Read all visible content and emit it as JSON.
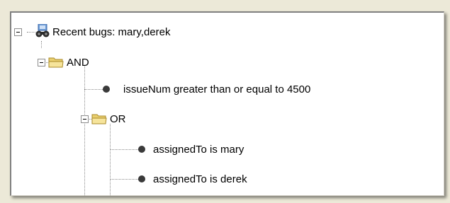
{
  "tree": {
    "root": {
      "label": "Recent bugs: mary,derek",
      "icon": "query-binoculars-icon",
      "expanded": true
    },
    "and_node": {
      "label": "AND",
      "icon": "folder-open-icon",
      "expanded": true
    },
    "cond_issue": {
      "label": "issueNum greater than or equal to 4500",
      "icon": "bullet-icon"
    },
    "or_node": {
      "label": "OR",
      "icon": "folder-open-icon",
      "expanded": true
    },
    "cond_mary": {
      "label": "assignedTo is mary",
      "icon": "bullet-icon"
    },
    "cond_derek": {
      "label": "assignedTo is derek",
      "icon": "bullet-icon"
    }
  }
}
